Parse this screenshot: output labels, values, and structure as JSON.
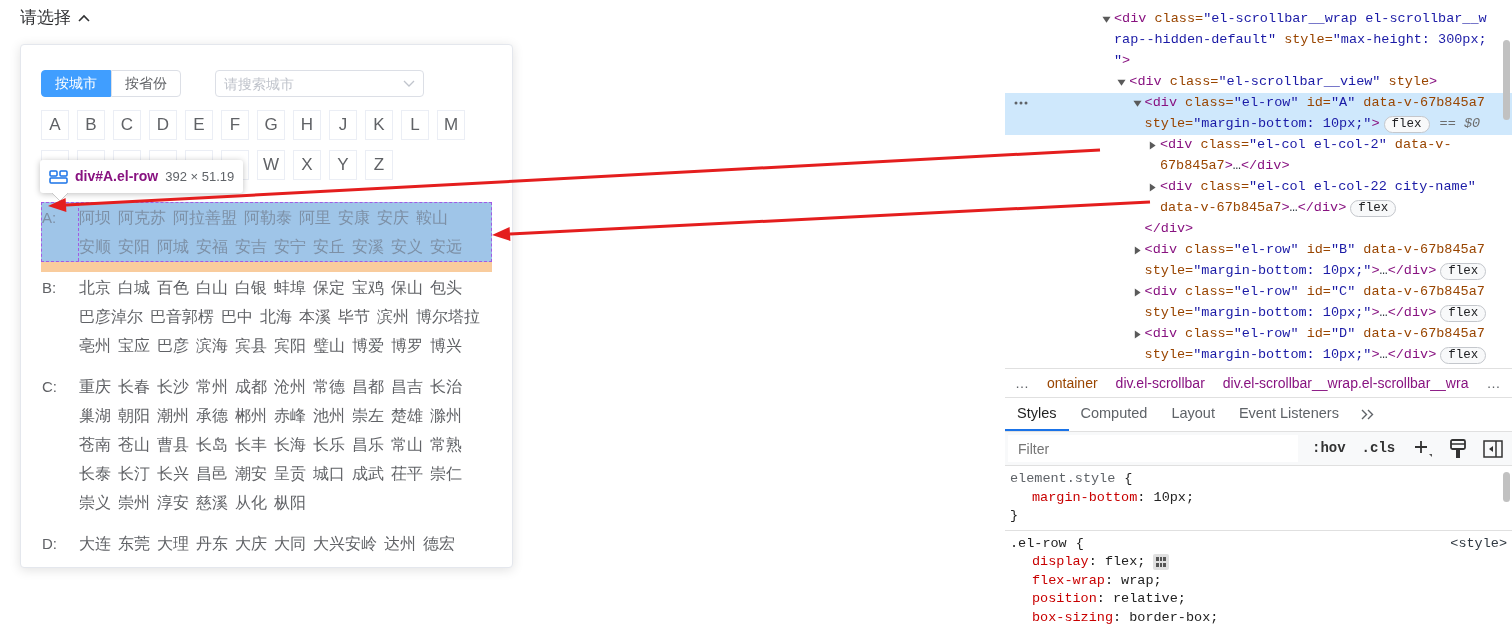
{
  "field": {
    "label": "请选择",
    "expanded": true
  },
  "popover": {
    "tabs": [
      {
        "label": "按城市",
        "selected": true
      },
      {
        "label": "按省份",
        "selected": false
      }
    ],
    "search": {
      "placeholder": "请搜索城市"
    },
    "letter_rows": [
      [
        {
          "kind": "letter",
          "label": "A"
        },
        {
          "kind": "letter",
          "label": "B"
        },
        {
          "kind": "letter",
          "label": "C"
        },
        {
          "kind": "letter",
          "label": "D"
        },
        {
          "kind": "letter",
          "label": "E"
        },
        {
          "kind": "letter",
          "label": "F"
        },
        {
          "kind": "letter",
          "label": "G"
        },
        {
          "kind": "letter",
          "label": "H"
        },
        {
          "kind": "letter",
          "label": "J"
        },
        {
          "kind": "letter",
          "label": "K"
        },
        {
          "kind": "letter",
          "label": "L"
        },
        {
          "kind": "letter",
          "label": "M"
        }
      ],
      [
        {
          "kind": "covered"
        },
        {
          "kind": "covered"
        },
        {
          "kind": "covered"
        },
        {
          "kind": "covered"
        },
        {
          "kind": "covered"
        },
        {
          "kind": "covered"
        },
        {
          "kind": "letter",
          "label": "W"
        },
        {
          "kind": "letter",
          "label": "X"
        },
        {
          "kind": "letter",
          "label": "Y"
        },
        {
          "kind": "letter",
          "label": "Z"
        }
      ]
    ],
    "inspect_tooltip": {
      "selector": "div#A.el-row",
      "size": "392 × 51.19"
    },
    "city_groups": [
      {
        "letter": "A:",
        "highlighted": true,
        "cities": [
          "阿坝",
          "阿克苏",
          "阿拉善盟",
          "阿勒泰",
          "阿里",
          "安康",
          "安庆",
          "鞍山",
          "安顺",
          "安阳",
          "阿城",
          "安福",
          "安吉",
          "安宁",
          "安丘",
          "安溪",
          "安义",
          "安远"
        ]
      },
      {
        "letter": "B:",
        "highlighted": false,
        "cities": [
          "北京",
          "白城",
          "百色",
          "白山",
          "白银",
          "蚌埠",
          "保定",
          "宝鸡",
          "保山",
          "包头",
          "巴彦淖尔",
          "巴音郭楞",
          "巴中",
          "北海",
          "本溪",
          "毕节",
          "滨州",
          "博尔塔拉",
          "亳州",
          "宝应",
          "巴彦",
          "滨海",
          "宾县",
          "宾阳",
          "璧山",
          "博爱",
          "博罗",
          "博兴"
        ]
      },
      {
        "letter": "C:",
        "highlighted": false,
        "cities": [
          "重庆",
          "长春",
          "长沙",
          "常州",
          "成都",
          "沧州",
          "常德",
          "昌都",
          "昌吉",
          "长治",
          "巢湖",
          "朝阳",
          "潮州",
          "承德",
          "郴州",
          "赤峰",
          "池州",
          "崇左",
          "楚雄",
          "滁州",
          "苍南",
          "苍山",
          "曹县",
          "长岛",
          "长丰",
          "长海",
          "长乐",
          "昌乐",
          "常山",
          "常熟",
          "长泰",
          "长汀",
          "长兴",
          "昌邑",
          "潮安",
          "呈贡",
          "城口",
          "成武",
          "茌平",
          "崇仁",
          "崇义",
          "崇州",
          "淳安",
          "慈溪",
          "从化",
          "枞阳"
        ]
      },
      {
        "letter": "D:",
        "highlighted": false,
        "cities": [
          "大连",
          "东莞",
          "大理",
          "丹东",
          "大庆",
          "大同",
          "大兴安岭",
          "达州",
          "德宏"
        ]
      }
    ]
  },
  "devtools": {
    "elements_tree": [
      {
        "expanded": true,
        "selected": false,
        "lines": [
          [
            {
              "kind": "tag",
              "text": "<div"
            },
            {
              "kind": "attr",
              "text": " class="
            },
            {
              "kind": "value",
              "text": "\"el-scrollbar__wrap el-scrollbar__w"
            }
          ],
          [
            {
              "kind": "value",
              "text": "rap--hidden-default\""
            },
            {
              "kind": "attr",
              "text": " style="
            },
            {
              "kind": "value",
              "text": "\"max-height: 300px;"
            }
          ],
          [
            {
              "kind": "value",
              "text": "\""
            },
            {
              "kind": "tag",
              "text": ">"
            }
          ]
        ],
        "children": [
          {
            "expanded": true,
            "selected": false,
            "lines": [
              [
                {
                  "kind": "tag",
                  "text": "<div"
                },
                {
                  "kind": "attr",
                  "text": " class="
                },
                {
                  "kind": "value",
                  "text": "\"el-scrollbar__view\""
                },
                {
                  "kind": "attr",
                  "text": " style"
                },
                {
                  "kind": "tag",
                  "text": ">"
                }
              ]
            ],
            "children": [
              {
                "expanded": true,
                "selected": true,
                "lines": [
                  [
                    {
                      "kind": "tag",
                      "text": "<div"
                    },
                    {
                      "kind": "attr",
                      "text": " class="
                    },
                    {
                      "kind": "value",
                      "text": "\"el-row\""
                    },
                    {
                      "kind": "attr",
                      "text": " id="
                    },
                    {
                      "kind": "value",
                      "text": "\"A\""
                    },
                    {
                      "kind": "attr",
                      "text": " data-v-67b845a7"
                    }
                  ],
                  [
                    {
                      "kind": "attr",
                      "text": "style="
                    },
                    {
                      "kind": "value",
                      "text": "\"margin-bottom: 10px;\""
                    },
                    {
                      "kind": "tag",
                      "text": ">"
                    }
                  ]
                ],
                "badge": "flex",
                "marker": "== *$0*",
                "children": [
                  {
                    "expanded": false,
                    "selected": false,
                    "lines": [
                      [
                        {
                          "kind": "tag",
                          "text": "<div"
                        },
                        {
                          "kind": "attr",
                          "text": " class="
                        },
                        {
                          "kind": "value",
                          "text": "\"el-col el-col-2\""
                        },
                        {
                          "kind": "attr",
                          "text": " data-v-"
                        }
                      ],
                      [
                        {
                          "kind": "attr",
                          "text": "67b845a7"
                        },
                        {
                          "kind": "tag",
                          "text": ">"
                        },
                        {
                          "kind": "plain",
                          "text": "…"
                        },
                        {
                          "kind": "tag",
                          "text": "</div>"
                        }
                      ]
                    ]
                  },
                  {
                    "expanded": false,
                    "selected": false,
                    "lines": [
                      [
                        {
                          "kind": "tag",
                          "text": "<div"
                        },
                        {
                          "kind": "attr",
                          "text": " class="
                        },
                        {
                          "kind": "value",
                          "text": "\"el-col el-col-22 city-name\""
                        }
                      ],
                      [
                        {
                          "kind": "attr",
                          "text": "data-v-67b845a7"
                        },
                        {
                          "kind": "tag",
                          "text": ">"
                        },
                        {
                          "kind": "plain",
                          "text": "…"
                        },
                        {
                          "kind": "tag",
                          "text": "</div>"
                        }
                      ]
                    ],
                    "badge": "flex"
                  }
                ],
                "closing": [
                  [
                    {
                      "kind": "tag",
                      "text": "</div>"
                    }
                  ]
                ]
              },
              {
                "expanded": false,
                "selected": false,
                "lines": [
                  [
                    {
                      "kind": "tag",
                      "text": "<div"
                    },
                    {
                      "kind": "attr",
                      "text": " class="
                    },
                    {
                      "kind": "value",
                      "text": "\"el-row\""
                    },
                    {
                      "kind": "attr",
                      "text": " id="
                    },
                    {
                      "kind": "value",
                      "text": "\"B\""
                    },
                    {
                      "kind": "attr",
                      "text": " data-v-67b845a7"
                    }
                  ],
                  [
                    {
                      "kind": "attr",
                      "text": "style="
                    },
                    {
                      "kind": "value",
                      "text": "\"margin-bottom: 10px;\""
                    },
                    {
                      "kind": "tag",
                      "text": ">"
                    },
                    {
                      "kind": "plain",
                      "text": "…"
                    },
                    {
                      "kind": "tag",
                      "text": "</div>"
                    }
                  ]
                ],
                "badge": "flex"
              },
              {
                "expanded": false,
                "selected": false,
                "lines": [
                  [
                    {
                      "kind": "tag",
                      "text": "<div"
                    },
                    {
                      "kind": "attr",
                      "text": " class="
                    },
                    {
                      "kind": "value",
                      "text": "\"el-row\""
                    },
                    {
                      "kind": "attr",
                      "text": " id="
                    },
                    {
                      "kind": "value",
                      "text": "\"C\""
                    },
                    {
                      "kind": "attr",
                      "text": " data-v-67b845a7"
                    }
                  ],
                  [
                    {
                      "kind": "attr",
                      "text": "style="
                    },
                    {
                      "kind": "value",
                      "text": "\"margin-bottom: 10px;\""
                    },
                    {
                      "kind": "tag",
                      "text": ">"
                    },
                    {
                      "kind": "plain",
                      "text": "…"
                    },
                    {
                      "kind": "tag",
                      "text": "</div>"
                    }
                  ]
                ],
                "badge": "flex"
              },
              {
                "expanded": false,
                "selected": false,
                "lines": [
                  [
                    {
                      "kind": "tag",
                      "text": "<div"
                    },
                    {
                      "kind": "attr",
                      "text": " class="
                    },
                    {
                      "kind": "value",
                      "text": "\"el-row\""
                    },
                    {
                      "kind": "attr",
                      "text": " id="
                    },
                    {
                      "kind": "value",
                      "text": "\"D\""
                    },
                    {
                      "kind": "attr",
                      "text": " data-v-67b845a7"
                    }
                  ],
                  [
                    {
                      "kind": "attr",
                      "text": "style="
                    },
                    {
                      "kind": "value",
                      "text": "\"margin-bottom: 10px;\""
                    },
                    {
                      "kind": "tag",
                      "text": ">"
                    },
                    {
                      "kind": "plain",
                      "text": "…"
                    },
                    {
                      "kind": "tag",
                      "text": "</div>"
                    }
                  ]
                ],
                "badge": "flex"
              }
            ]
          }
        ]
      }
    ],
    "breadcrumbs": [
      {
        "kind": "overflow",
        "text": "…"
      },
      {
        "kind": "class",
        "text": "ontainer"
      },
      {
        "kind": "node",
        "text": "div.el-scrollbar"
      },
      {
        "kind": "node",
        "text": "div.el-scrollbar__wrap.el-scrollbar__wra"
      },
      {
        "kind": "overflow",
        "text": "…"
      }
    ],
    "tabs": [
      {
        "label": "Styles",
        "selected": true
      },
      {
        "label": "Computed",
        "selected": false
      },
      {
        "label": "Layout",
        "selected": false
      },
      {
        "label": "Event Listeners",
        "selected": false
      }
    ],
    "filter": {
      "placeholder": "Filter",
      "buttons": [
        ":hov",
        ".cls"
      ]
    },
    "rules": [
      {
        "selector": "element.style",
        "open_brace": "{",
        "declarations": [
          {
            "text": "margin-bottom: 10px;",
            "flex_editor": false
          }
        ],
        "close_brace": "}"
      },
      {
        "selector": ".el-row",
        "open_brace": "{",
        "source": "<style>",
        "declarations": [
          {
            "text": "display: flex;",
            "flex_editor": true
          },
          {
            "text": "flex-wrap: wrap;",
            "flex_editor": false
          },
          {
            "text": "position: relative;",
            "flex_editor": false
          },
          {
            "text": "box-sizing: border-box;",
            "flex_editor": false
          }
        ]
      }
    ]
  }
}
